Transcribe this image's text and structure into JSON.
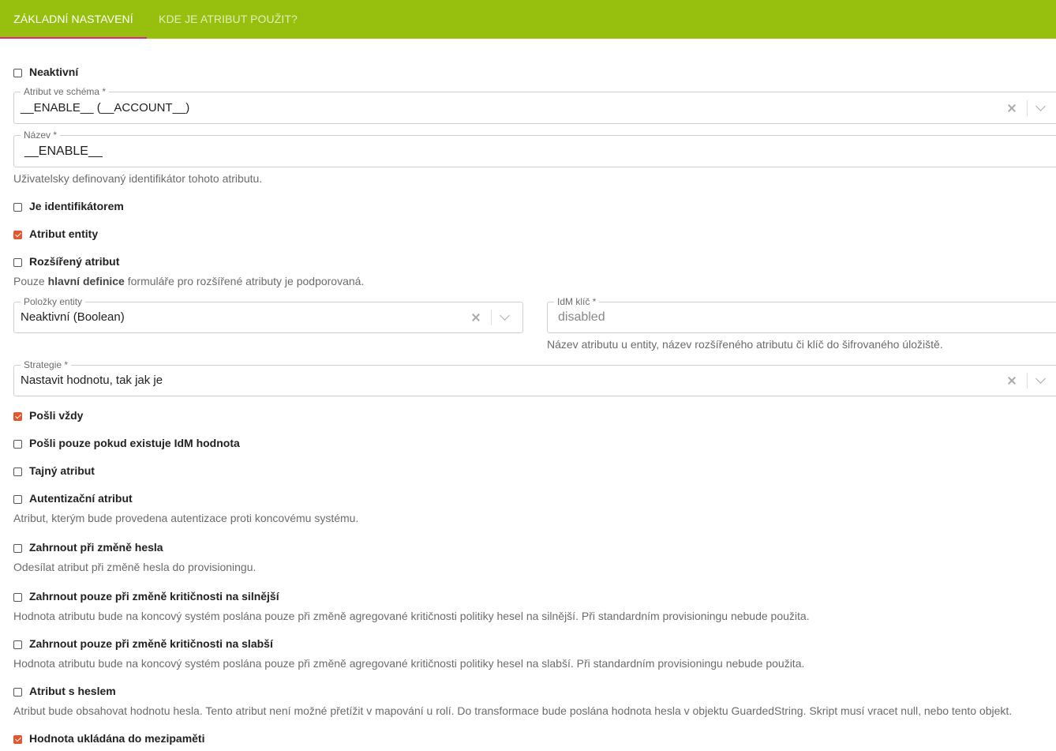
{
  "tabs": [
    {
      "label": "Základní nastavení"
    },
    {
      "label": "Kde je atribut použit?"
    }
  ],
  "colors": {
    "accent": "#97bf0d",
    "indicator": "#e2257c",
    "checkbox_checked": "#e2572b"
  },
  "form": {
    "inactive": {
      "label": "Neaktivní",
      "checked": false
    },
    "schema_attribute": {
      "label": "Atribut ve schéma *",
      "value": "__ENABLE__ (__ACCOUNT__)"
    },
    "name": {
      "label": "Název *",
      "value": "__ENABLE__",
      "help": "Uživatelsky definovaný identifikátor tohoto atributu."
    },
    "is_identifier": {
      "label": "Je identifikátorem",
      "checked": false
    },
    "entity_attribute": {
      "label": "Atribut entity",
      "checked": true
    },
    "extended_attribute": {
      "label": "Rozšířený atribut",
      "checked": false,
      "help_prefix": "Pouze ",
      "help_bold": "hlavní definice",
      "help_suffix": " formuláře pro rozšířené atributy je podporovaná."
    },
    "entity_items": {
      "label": "Položky entity",
      "value": "Neaktivní (Boolean)"
    },
    "idm_key": {
      "label": "IdM klíč *",
      "value": "disabled",
      "help": "Název atributu u entity, název rozšířeného atributu či klíč do šifrovaného úložiště."
    },
    "strategy": {
      "label": "Strategie *",
      "value": "Nastavit hodnotu, tak jak je"
    },
    "send_always": {
      "label": "Pošli vždy",
      "checked": true
    },
    "send_if_idm_value": {
      "label": "Pošli pouze pokud existuje IdM hodnota",
      "checked": false
    },
    "secret_attribute": {
      "label": "Tajný atribut",
      "checked": false
    },
    "auth_attribute": {
      "label": "Autentizační atribut",
      "checked": false,
      "help": "Atribut, kterým bude provedena autentizace proti koncovému systému."
    },
    "include_password_change": {
      "label": "Zahrnout při změně hesla",
      "checked": false,
      "help": "Odesílat atribut při změně hesla do provisioningu."
    },
    "include_stronger": {
      "label": "Zahrnout pouze při změně kritičnosti na silnější",
      "checked": false,
      "help": "Hodnota atributu bude na koncový systém poslána pouze při změně agregované kritičnosti politiky hesel na silnější. Při standardním provisioningu nebude použita."
    },
    "include_weaker": {
      "label": "Zahrnout pouze při změně kritičnosti na slabší",
      "checked": false,
      "help": "Hodnota atributu bude na koncový systém poslána pouze při změně agregované kritičnosti politiky hesel na slabší. Při standardním provisioningu nebude použita."
    },
    "password_attribute": {
      "label": "Atribut s heslem",
      "checked": false,
      "help": "Atribut bude obsahovat hodnotu hesla. Tento atribut není možné přetížit v mapování u rolí. Do transformace bude poslána hodnota hesla v objektu GuardedString. Skript musí vracet null, nebo tento objekt."
    },
    "cached_value": {
      "label": "Hodnota ukládána do mezipaměti",
      "checked": true
    }
  }
}
